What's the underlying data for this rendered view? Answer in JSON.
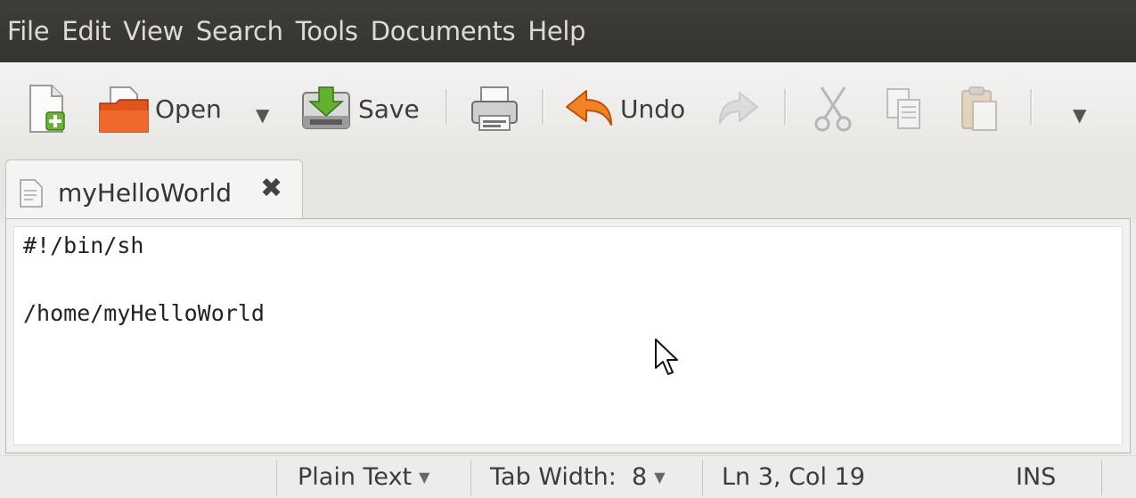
{
  "menubar": {
    "items": [
      "File",
      "Edit",
      "View",
      "Search",
      "Tools",
      "Documents",
      "Help"
    ]
  },
  "toolbar": {
    "new_icon": "new-document-icon",
    "open_label": "Open",
    "save_label": "Save",
    "print_icon": "printer-icon",
    "undo_label": "Undo",
    "redo_icon": "redo-arrow-icon",
    "cut_icon": "scissors-icon",
    "copy_icon": "copy-icon",
    "paste_icon": "paste-clipboard-icon",
    "dropdown_glyph": "▼"
  },
  "tabs": [
    {
      "label": "myHelloWorld",
      "close_glyph": "✖"
    }
  ],
  "editor": {
    "lines": [
      "#!/bin/sh",
      "",
      "/home/myHelloWorld"
    ]
  },
  "statusbar": {
    "language": "Plain Text",
    "tab_width": "Tab Width:  8",
    "position": "Ln 3, Col 19",
    "mode": "INS",
    "arrow_glyph": "▼"
  },
  "colors": {
    "menubar_bg": "#3c3b37",
    "menubar_text": "#dfdbd2",
    "window_bg": "#edeceb",
    "undo_orange": "#e8761d",
    "open_orange": "#e0501a",
    "save_green": "#5aa22a"
  }
}
